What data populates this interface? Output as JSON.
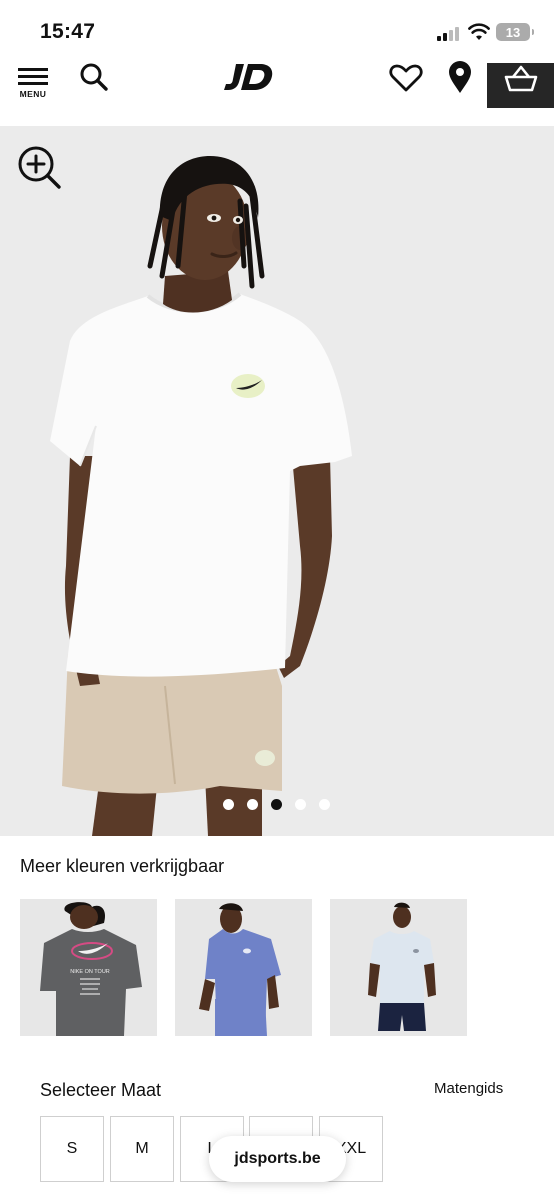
{
  "status_bar": {
    "time": "15:47",
    "battery": "13"
  },
  "header": {
    "menu_label": "MENU",
    "logo_icon": "jd-logo",
    "icons": [
      "search-icon",
      "heart-icon",
      "location-pin-icon",
      "basket-icon"
    ]
  },
  "product_gallery": {
    "zoom_icon": "zoom-in-icon",
    "image_count": 5,
    "active_image": 3
  },
  "colors": {
    "title": "Meer kleuren verkrijgbaar",
    "swatches": [
      {
        "name": "grey-tee-back",
        "shirt_color": "#5f6062",
        "print_text": "NIKE ON TOUR"
      },
      {
        "name": "blue-tee",
        "shirt_color": "#6f82c8"
      },
      {
        "name": "light-blue-tee",
        "shirt_color": "#dde6ef"
      }
    ]
  },
  "size": {
    "title": "Selecteer Maat",
    "guide_label": "Matengids",
    "options": [
      "S",
      "M",
      "L",
      "XL",
      "XXL"
    ]
  },
  "browser": {
    "url": "jdsports.be"
  },
  "colors_palette": {
    "accent_dark": "#262626",
    "hero_bg": "#ebebeb"
  }
}
